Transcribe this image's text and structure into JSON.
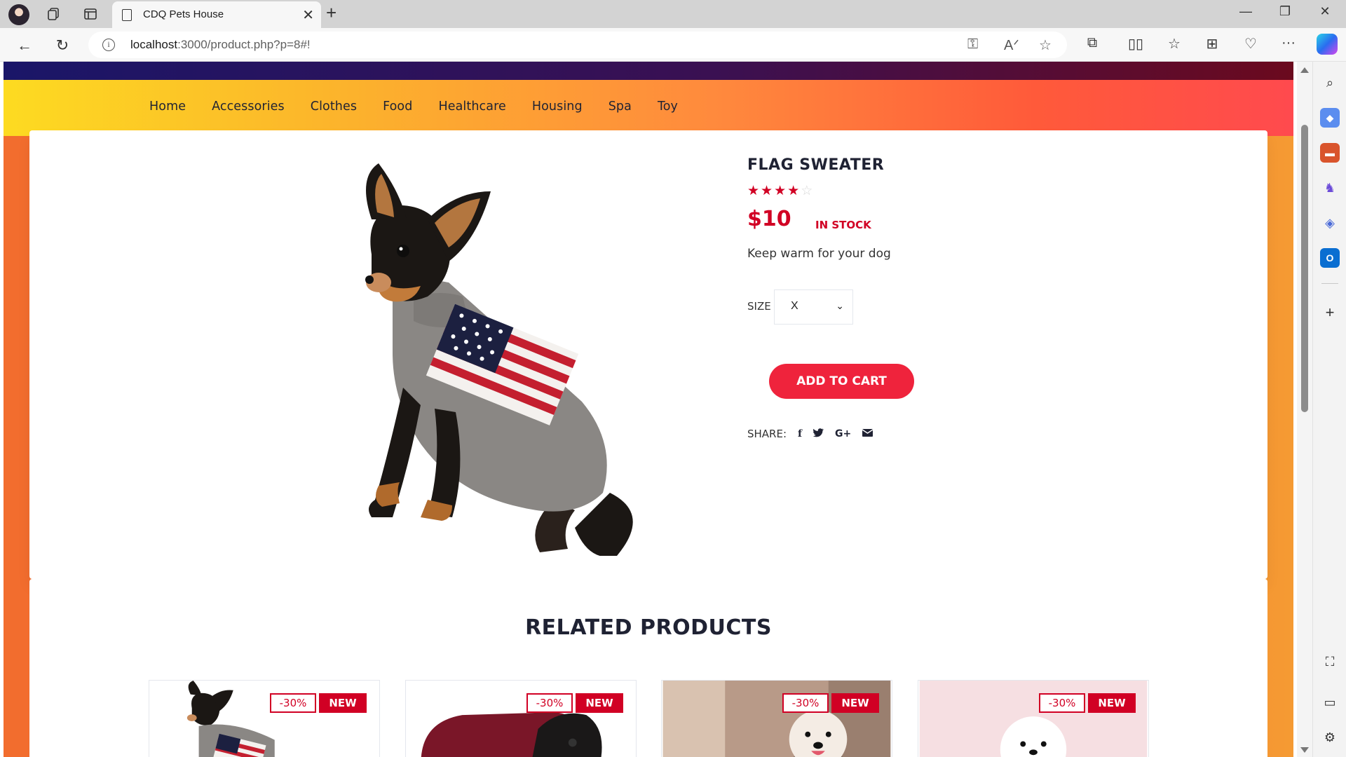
{
  "browser": {
    "tab_title": "CDQ Pets House",
    "url_host": "localhost",
    "url_rest": ":3000/product.php?p=8#!"
  },
  "nav": {
    "items": [
      "Home",
      "Accessories",
      "Clothes",
      "Food",
      "Healthcare",
      "Housing",
      "Spa",
      "Toy"
    ]
  },
  "product": {
    "name": "FLAG SWEATER",
    "rating": 4,
    "rating_max": 5,
    "price": "$10",
    "stock": "IN STOCK",
    "description": "Keep warm for your dog",
    "size_label": "SIZE",
    "size_value": "X",
    "add_to_cart": "ADD TO CART",
    "share_label": "SHARE:",
    "share_icons": [
      "facebook-icon",
      "twitter-icon",
      "google-plus-icon",
      "envelope-icon"
    ]
  },
  "related": {
    "title": "RELATED PRODUCTS",
    "items": [
      {
        "sale": "-30%",
        "new": "NEW"
      },
      {
        "sale": "-30%",
        "new": "NEW"
      },
      {
        "sale": "-30%",
        "new": "NEW"
      },
      {
        "sale": "-30%",
        "new": "NEW"
      }
    ]
  },
  "colors": {
    "accent": "#d10024",
    "button": "#ef233c",
    "dark_text": "#1f2233"
  }
}
